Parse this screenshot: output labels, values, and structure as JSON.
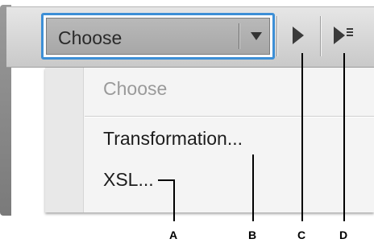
{
  "toolbar": {
    "dropdown_value": "Choose",
    "run_icon": "play-icon",
    "run_options_icon": "play-with-menu-icon"
  },
  "menu": {
    "items": [
      {
        "label": "Choose",
        "enabled": false
      },
      {
        "label": "Transformation...",
        "enabled": true
      },
      {
        "label": "XSL...",
        "enabled": true
      }
    ]
  },
  "callouts": {
    "a": "A",
    "b": "B",
    "c": "C",
    "d": "D"
  },
  "colors": {
    "focus_border": "#3d8fd6",
    "disabled_text": "#9a9a9a"
  }
}
